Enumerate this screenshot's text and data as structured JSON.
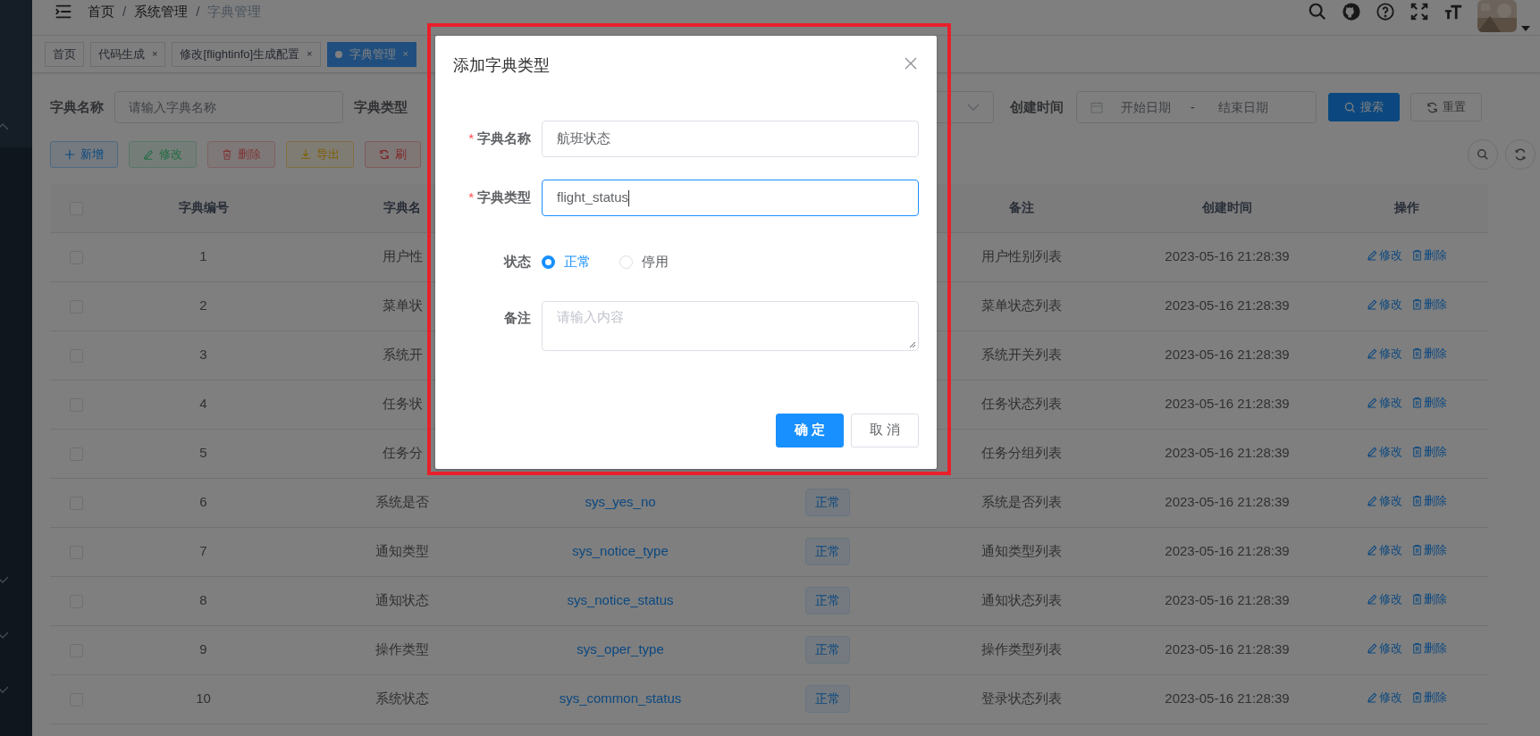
{
  "breadcrumb": {
    "separator": "/",
    "items": [
      {
        "label": "首页"
      },
      {
        "label": "系统管理"
      },
      {
        "label": "字典管理"
      }
    ]
  },
  "tags": [
    {
      "label": "首页",
      "selected": false
    },
    {
      "label": "代码生成",
      "selected": false,
      "close": "×"
    },
    {
      "label": "修改[flightinfo]生成配置",
      "selected": false,
      "close": "×"
    },
    {
      "label": "字典管理",
      "selected": true,
      "close": "×"
    }
  ],
  "search_form": {
    "name_label": "字典名称",
    "name_placeholder": "请输入字典名称",
    "type_label": "字典类型",
    "date_label": "创建时间",
    "start_placeholder": "开始日期",
    "range_separator": "-",
    "end_placeholder": "结束日期",
    "buttons": [
      {
        "label": "搜索",
        "kind": "primary"
      },
      {
        "label": "重置",
        "kind": "default"
      }
    ]
  },
  "toolbar": [
    {
      "label": "新增",
      "kind": "primary",
      "disabled": false
    },
    {
      "label": "修改",
      "kind": "success",
      "disabled": true
    },
    {
      "label": "删除",
      "kind": "danger",
      "disabled": true
    },
    {
      "label": "导出",
      "kind": "warning",
      "disabled": false
    },
    {
      "label": "刷",
      "kind": "danger",
      "disabled": false
    }
  ],
  "table": {
    "all_checked": false,
    "columns": {
      "id": "字典编号",
      "name": "字典名",
      "remark": "备注",
      "created": "创建时间",
      "actions": "操作"
    },
    "rows": [
      {
        "checked": false,
        "id": "1",
        "name": "用户性",
        "remark": "用户性别列表",
        "created": "2023-05-16 21:28:39",
        "actions": [
          {
            "kind": "edit",
            "label": "修改"
          },
          {
            "kind": "delete",
            "label": "删除"
          }
        ]
      },
      {
        "checked": false,
        "id": "2",
        "name": "菜单状",
        "remark": "菜单状态列表",
        "created": "2023-05-16 21:28:39",
        "actions": [
          {
            "kind": "edit",
            "label": "修改"
          },
          {
            "kind": "delete",
            "label": "删除"
          }
        ]
      },
      {
        "checked": false,
        "id": "3",
        "name": "系统开",
        "remark": "系统开关列表",
        "created": "2023-05-16 21:28:39",
        "actions": [
          {
            "kind": "edit",
            "label": "修改"
          },
          {
            "kind": "delete",
            "label": "删除"
          }
        ]
      },
      {
        "checked": false,
        "id": "4",
        "name": "任务状",
        "remark": "任务状态列表",
        "created": "2023-05-16 21:28:39",
        "actions": [
          {
            "kind": "edit",
            "label": "修改"
          },
          {
            "kind": "delete",
            "label": "删除"
          }
        ]
      },
      {
        "checked": false,
        "id": "5",
        "name": "任务分",
        "remark": "任务分组列表",
        "created": "2023-05-16 21:28:39",
        "actions": [
          {
            "kind": "edit",
            "label": "修改"
          },
          {
            "kind": "delete",
            "label": "删除"
          }
        ]
      },
      {
        "checked": false,
        "id": "6",
        "name": "系统是否",
        "type": "sys_yes_no",
        "status": "正常",
        "remark": "系统是否列表",
        "created": "2023-05-16 21:28:39",
        "actions": [
          {
            "kind": "edit",
            "label": "修改"
          },
          {
            "kind": "delete",
            "label": "删除"
          }
        ]
      },
      {
        "checked": false,
        "id": "7",
        "name": "通知类型",
        "type": "sys_notice_type",
        "status": "正常",
        "remark": "通知类型列表",
        "created": "2023-05-16 21:28:39",
        "actions": [
          {
            "kind": "edit",
            "label": "修改"
          },
          {
            "kind": "delete",
            "label": "删除"
          }
        ]
      },
      {
        "checked": false,
        "id": "8",
        "name": "通知状态",
        "type": "sys_notice_status",
        "status": "正常",
        "remark": "通知状态列表",
        "created": "2023-05-16 21:28:39",
        "actions": [
          {
            "kind": "edit",
            "label": "修改"
          },
          {
            "kind": "delete",
            "label": "删除"
          }
        ]
      },
      {
        "checked": false,
        "id": "9",
        "name": "操作类型",
        "type": "sys_oper_type",
        "status": "正常",
        "remark": "操作类型列表",
        "created": "2023-05-16 21:28:39",
        "actions": [
          {
            "kind": "edit",
            "label": "修改"
          },
          {
            "kind": "delete",
            "label": "删除"
          }
        ]
      },
      {
        "checked": false,
        "id": "10",
        "name": "系统状态",
        "type": "sys_common_status",
        "status": "正常",
        "remark": "登录状态列表",
        "created": "2023-05-16 21:28:39",
        "actions": [
          {
            "kind": "edit",
            "label": "修改"
          },
          {
            "kind": "delete",
            "label": "删除"
          }
        ]
      }
    ]
  },
  "dialog": {
    "title": "添加字典类型",
    "fields": [
      {
        "kind": "text",
        "label": "字典名称",
        "required_mark": "*",
        "value": "航班状态",
        "focused": false
      },
      {
        "kind": "text",
        "label": "字典类型",
        "required_mark": "*",
        "value": "flight_status",
        "focused": true
      },
      {
        "kind": "radio",
        "label": "状态",
        "options": [
          {
            "label": "正常",
            "selected": true
          },
          {
            "label": "停用",
            "selected": false
          }
        ]
      },
      {
        "kind": "textarea",
        "label": "备注",
        "placeholder": "请输入内容"
      }
    ],
    "buttons": [
      {
        "label": "确 定",
        "kind": "primary"
      },
      {
        "label": "取 消",
        "kind": "default"
      }
    ]
  }
}
